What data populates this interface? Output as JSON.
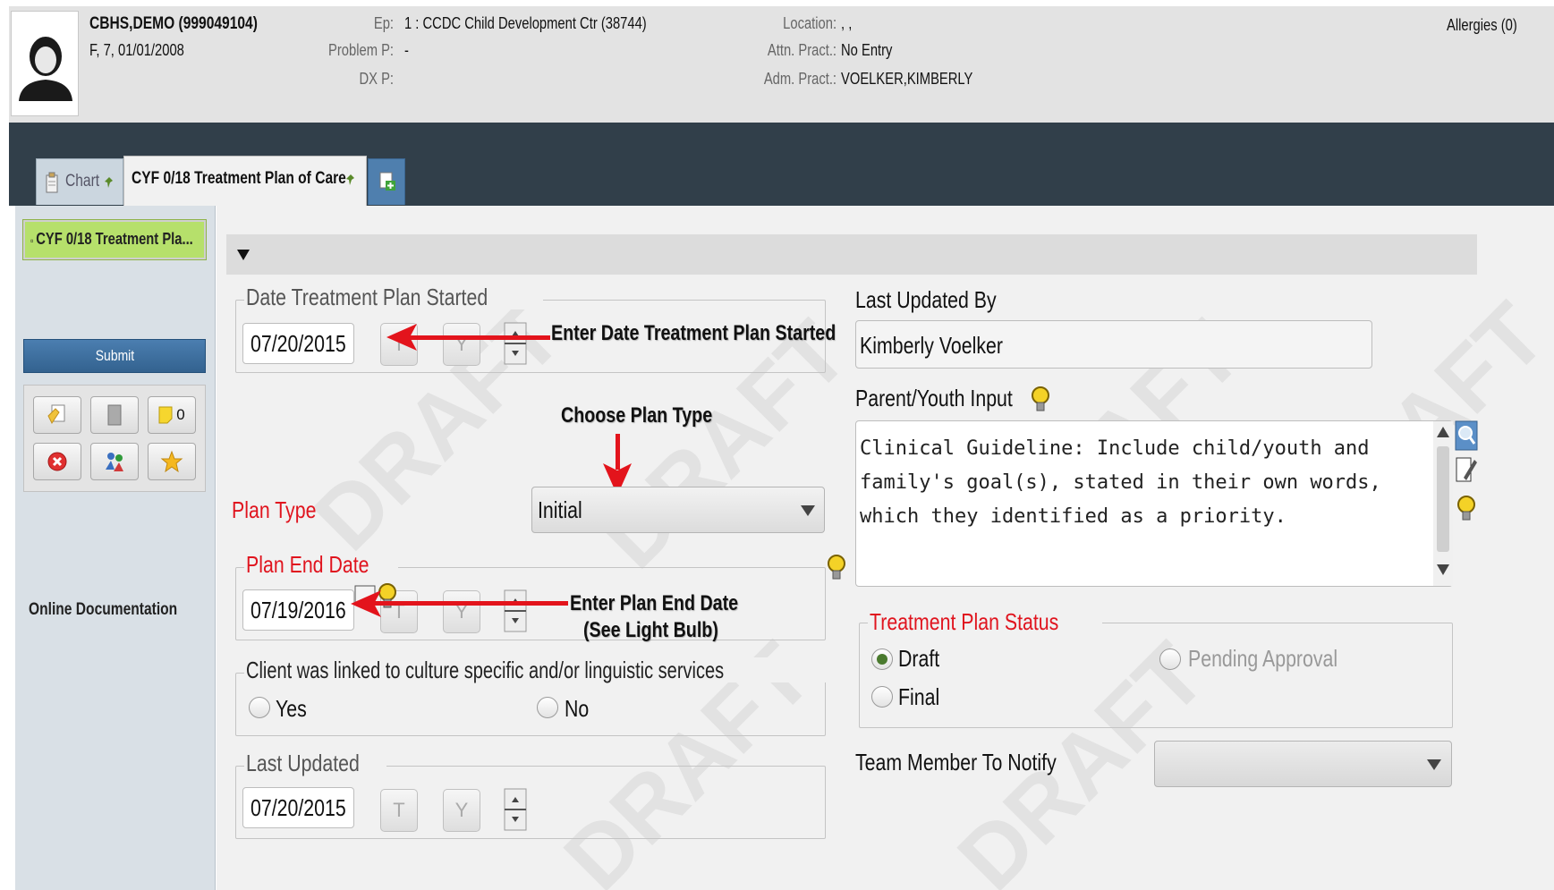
{
  "patient": {
    "name": "CBHS,DEMO (999049104)",
    "demographics": "F, 7, 01/01/2008",
    "ep_label": "Ep:",
    "ep_value": "1 : CCDC Child Development Ctr (38744)",
    "problem_label": "Problem P:",
    "problem_value": "-",
    "dx_label": "DX P:",
    "location_label": "Location:",
    "location_value": ", ,",
    "attn_label": "Attn. Pract.:",
    "attn_value": "No Entry",
    "adm_label": "Adm. Pract.:",
    "adm_value": "VOELKER,KIMBERLY",
    "allergies": "Allergies (0)"
  },
  "tabs": [
    {
      "label": "Chart"
    },
    {
      "label": "CYF 0/18 Treatment Plan of Care"
    }
  ],
  "sidebar": {
    "form_item": "CYF 0/18 Treatment Pla...",
    "submit_label": "Submit",
    "notes_count": "0",
    "online_doc": "Online Documentation"
  },
  "form": {
    "date_started_legend": "Date Treatment Plan Started",
    "date_started_value": "07/20/2015",
    "plan_type_label": "Plan Type",
    "plan_type_value": "Initial",
    "plan_end_legend": "Plan End Date",
    "plan_end_value": "07/19/2016",
    "linked_legend": "Client was linked to culture specific and/or linguistic services",
    "linked_yes": "Yes",
    "linked_no": "No",
    "last_updated_legend": "Last Updated",
    "last_updated_value": "07/20/2015",
    "today_btn": "T",
    "yesterday_btn": "Y",
    "last_updated_by_label": "Last Updated By",
    "last_updated_by_value": "Kimberly Voelker",
    "parent_input_label": "Parent/Youth Input",
    "parent_input_text": "Clinical Guideline: Include child/youth and\nfamily's goal(s), stated in their own words,\nwhich they identified as a priority.",
    "status_legend": "Treatment Plan Status",
    "status_draft": "Draft",
    "status_pending": "Pending Approval",
    "status_final": "Final",
    "team_member_label": "Team Member To Notify",
    "team_member_value": ""
  },
  "annotations": {
    "date_started": "Enter Date Treatment Plan Started",
    "plan_type": "Choose Plan Type",
    "plan_end_line1": "Enter Plan End Date",
    "plan_end_line2": "(See Light Bulb)"
  },
  "watermark_text": "DRAFT",
  "colors": {
    "required_label": "#e0141e",
    "annotation_arrow": "#e3141c",
    "header_band": "#313f4a",
    "submit_button": "#3f6f9f",
    "form_item_highlight": "#b6e06b"
  }
}
